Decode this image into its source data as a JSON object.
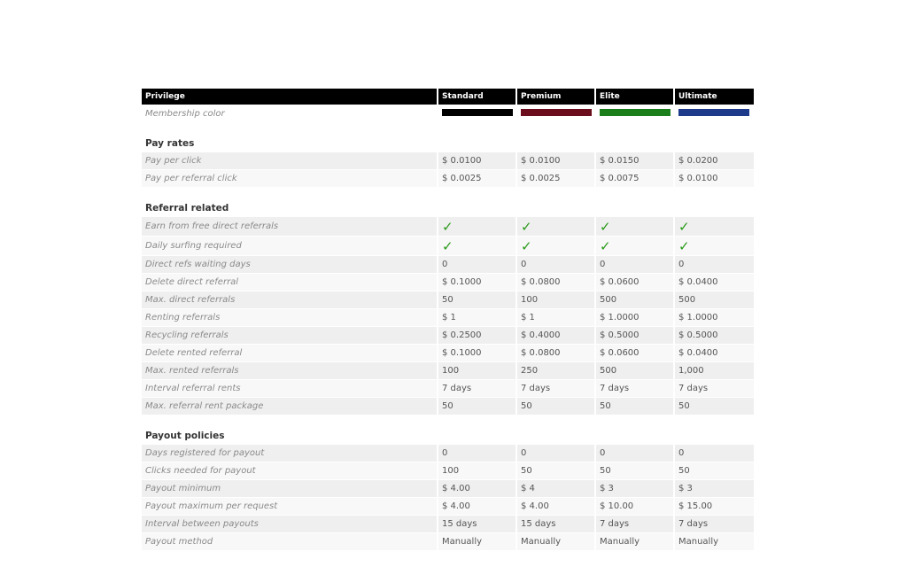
{
  "columns": [
    "Privilege",
    "Standard",
    "Premium",
    "Elite",
    "Ultimate"
  ],
  "membership": {
    "label": "Membership color",
    "colors": [
      "#000000",
      "#6b0d1c",
      "#1a7f1a",
      "#1d3b8a"
    ]
  },
  "sections": {
    "pay_rates": {
      "title": "Pay rates",
      "rows": [
        {
          "label": "Pay per click",
          "values": [
            "$ 0.0100",
            "$ 0.0100",
            "$ 0.0150",
            "$ 0.0200"
          ]
        },
        {
          "label": "Pay per referral click",
          "values": [
            "$ 0.0025",
            "$ 0.0025",
            "$ 0.0075",
            "$ 0.0100"
          ]
        }
      ]
    },
    "referral": {
      "title": "Referral related",
      "checks": [
        {
          "label": "Earn from free direct referrals",
          "values": [
            "✓",
            "✓",
            "✓",
            "✓"
          ]
        },
        {
          "label": "Daily surfing required",
          "values": [
            "✓",
            "✓",
            "✓",
            "✓"
          ]
        }
      ],
      "rows": [
        {
          "label": "Direct refs waiting days",
          "values": [
            "0",
            "0",
            "0",
            "0"
          ]
        },
        {
          "label": "Delete direct referral",
          "values": [
            "$ 0.1000",
            "$ 0.0800",
            "$ 0.0600",
            "$ 0.0400"
          ]
        },
        {
          "label": "Max. direct referrals",
          "values": [
            "50",
            "100",
            "500",
            "500"
          ]
        },
        {
          "label": "Renting referrals",
          "values": [
            "$ 1",
            "$ 1",
            "$ 1.0000",
            "$ 1.0000"
          ]
        },
        {
          "label": "Recycling referrals",
          "values": [
            "$ 0.2500",
            "$ 0.4000",
            "$ 0.5000",
            "$ 0.5000"
          ]
        },
        {
          "label": "Delete rented referral",
          "values": [
            "$ 0.1000",
            "$ 0.0800",
            "$ 0.0600",
            "$ 0.0400"
          ]
        },
        {
          "label": "Max. rented referrals",
          "values": [
            "100",
            "250",
            "500",
            "1,000"
          ]
        },
        {
          "label": "Interval referral rents",
          "values": [
            "7 days",
            "7 days",
            "7 days",
            "7 days"
          ]
        },
        {
          "label": "Max. referral rent package",
          "values": [
            "50",
            "50",
            "50",
            "50"
          ]
        }
      ]
    },
    "payout": {
      "title": "Payout policies",
      "rows": [
        {
          "label": "Days registered for payout",
          "values": [
            "0",
            "0",
            "0",
            "0"
          ]
        },
        {
          "label": "Clicks needed for payout",
          "values": [
            "100",
            "50",
            "50",
            "50"
          ]
        },
        {
          "label": "Payout minimum",
          "values": [
            "$ 4.00",
            "$ 4",
            "$ 3",
            "$ 3"
          ]
        },
        {
          "label": "Payout maximum per request",
          "values": [
            "$ 4.00",
            "$ 4.00",
            "$ 10.00",
            "$ 15.00"
          ]
        },
        {
          "label": "Interval between payouts",
          "values": [
            "15 days",
            "15 days",
            "7 days",
            "7 days"
          ]
        },
        {
          "label": "Payout method",
          "values": [
            "Manually",
            "Manually",
            "Manually",
            "Manually"
          ]
        }
      ]
    }
  }
}
